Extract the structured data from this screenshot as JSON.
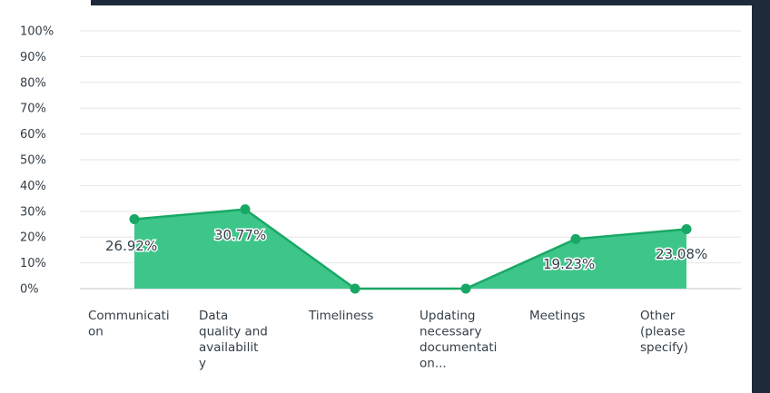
{
  "colors": {
    "area": "#3ec68a",
    "line": "#18a865",
    "grid": "#e6e6e6",
    "text": "#333e48",
    "frame": "#1e2a3a"
  },
  "chart_data": {
    "type": "area",
    "categories": [
      [
        "Communicati",
        "on"
      ],
      [
        "Data",
        "quality and",
        "availabilit",
        "y"
      ],
      [
        "Timeliness"
      ],
      [
        "Updating",
        "necessary",
        "documentati",
        "on..."
      ],
      [
        "Meetings"
      ],
      [
        "Other",
        "(please",
        "specify)"
      ]
    ],
    "values": [
      26.92,
      30.77,
      0,
      0,
      19.23,
      23.08
    ],
    "data_labels": [
      "26.92%",
      "30.77%",
      "",
      "",
      "19.23%",
      "23.08%"
    ],
    "yticks": [
      "0%",
      "10%",
      "20%",
      "30%",
      "40%",
      "50%",
      "60%",
      "70%",
      "80%",
      "90%",
      "100%"
    ],
    "ylim": [
      0,
      100
    ],
    "grid": true,
    "legend": "none"
  }
}
